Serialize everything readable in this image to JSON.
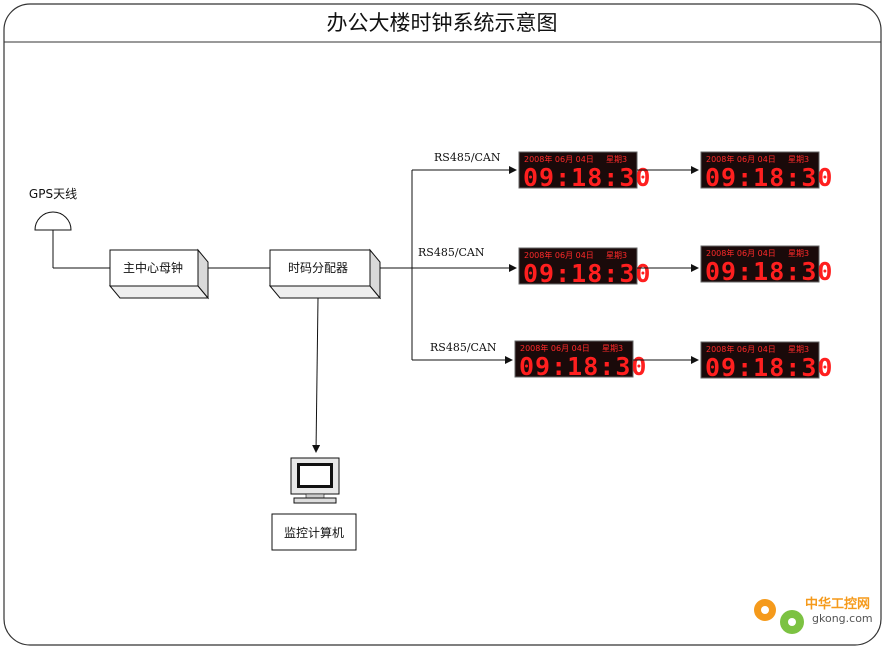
{
  "title": "办公大楼时钟系统示意图",
  "nodes": {
    "gps_antenna": "GPS天线",
    "master_clock": "主中心母钟",
    "distributor": "时码分配器",
    "monitor_pc": "监控计算机"
  },
  "bus_labels": [
    "RS485/CAN",
    "RS485/CAN",
    "RS485/CAN"
  ],
  "clock_display": {
    "date_line": "2008年 06月 04日",
    "weekday": "星期3",
    "time_digits": [
      "09",
      "18",
      "30"
    ],
    "colon": ":",
    "digit_color": "#ff1f1f",
    "panel_color": "#1a0a0a"
  },
  "watermark": {
    "name": "中华工控网",
    "site": "gkong.com"
  },
  "colors": {
    "line": "#111111",
    "box_face": "#ffffff",
    "box_side": "#d9d9d9",
    "logo_orange": "#f59a1b",
    "logo_green": "#7cc242"
  }
}
